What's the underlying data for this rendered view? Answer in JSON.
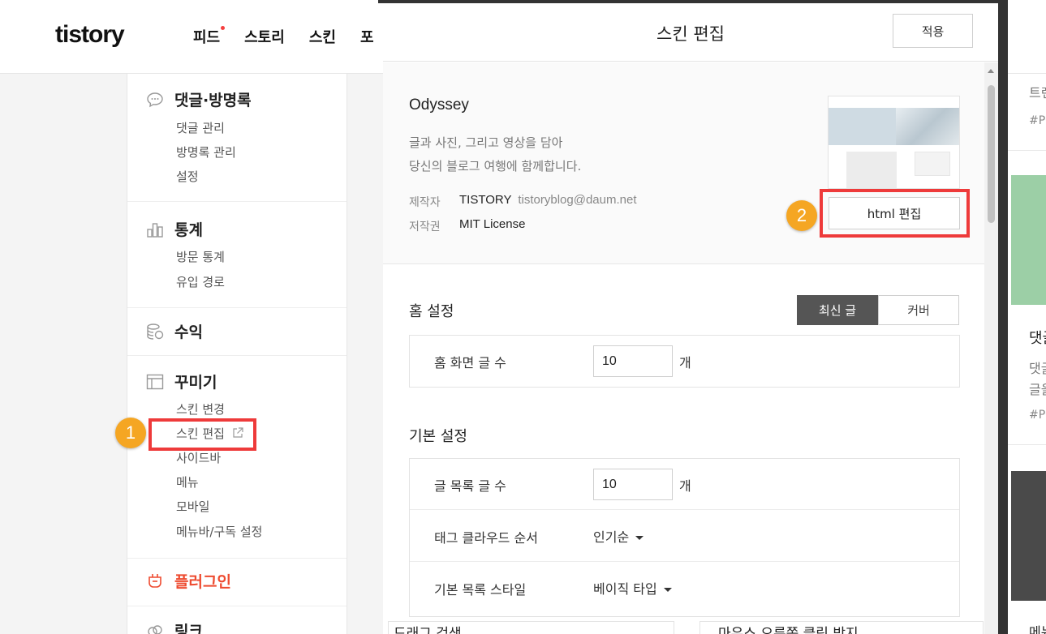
{
  "header": {
    "logo": "tistory",
    "nav": [
      "피드",
      "스토리",
      "스킨",
      "포"
    ]
  },
  "sidebar": {
    "sections": [
      {
        "title": "댓글·방명록",
        "icon": "comment-icon",
        "items": [
          "댓글 관리",
          "방명록 관리",
          "설정"
        ]
      },
      {
        "title": "통계",
        "icon": "bar-chart-icon",
        "items": [
          "방문 통계",
          "유입 경로"
        ]
      },
      {
        "title": "수익",
        "icon": "coins-icon",
        "items": []
      },
      {
        "title": "꾸미기",
        "icon": "layout-icon",
        "items": [
          "스킨 변경",
          "스킨 편집",
          "사이드바",
          "메뉴",
          "모바일",
          "메뉴바/구독 설정"
        ]
      },
      {
        "title": "플러그인",
        "icon": "plugin-icon",
        "items": []
      },
      {
        "title": "링크",
        "icon": "link-icon",
        "items": []
      }
    ]
  },
  "modal": {
    "title": "스킨 편집",
    "apply_label": "적용",
    "skin": {
      "name": "Odyssey",
      "desc_line1": "글과 사진, 그리고 영상을 담아",
      "desc_line2": "당신의 블로그 여행에 함께합니다.",
      "author_label": "제작자",
      "author": "TISTORY",
      "author_email": "tistoryblog@daum.net",
      "license_label": "저작권",
      "license": "MIT License",
      "html_edit_label": "html 편집"
    },
    "home": {
      "title": "홈 설정",
      "segments": [
        "최신 글",
        "커버"
      ],
      "active_segment": "최신 글",
      "posts_label": "홈 화면 글 수",
      "posts_value": "10",
      "unit": "개"
    },
    "basic": {
      "title": "기본 설정",
      "list_label": "글 목록 글 수",
      "list_value": "10",
      "unit": "개",
      "tag_order_label": "태그 클라우드 순서",
      "tag_order_value": "인기순",
      "list_style_label": "기본 목록 스타일",
      "list_style_value": "베이직 타입"
    },
    "bottom_cards": [
      "드래그 검색",
      "마우스 오른쪽 클릭 방지"
    ]
  },
  "right_preview": {
    "texts": [
      "트렌",
      "#PC",
      "댓글",
      "댓글",
      "글을",
      "#PC",
      "메뉴"
    ]
  },
  "annotations": {
    "step1": "1",
    "step2": "2",
    "highlight_color": "#ee3a3a",
    "badge_color": "#f5a623"
  }
}
